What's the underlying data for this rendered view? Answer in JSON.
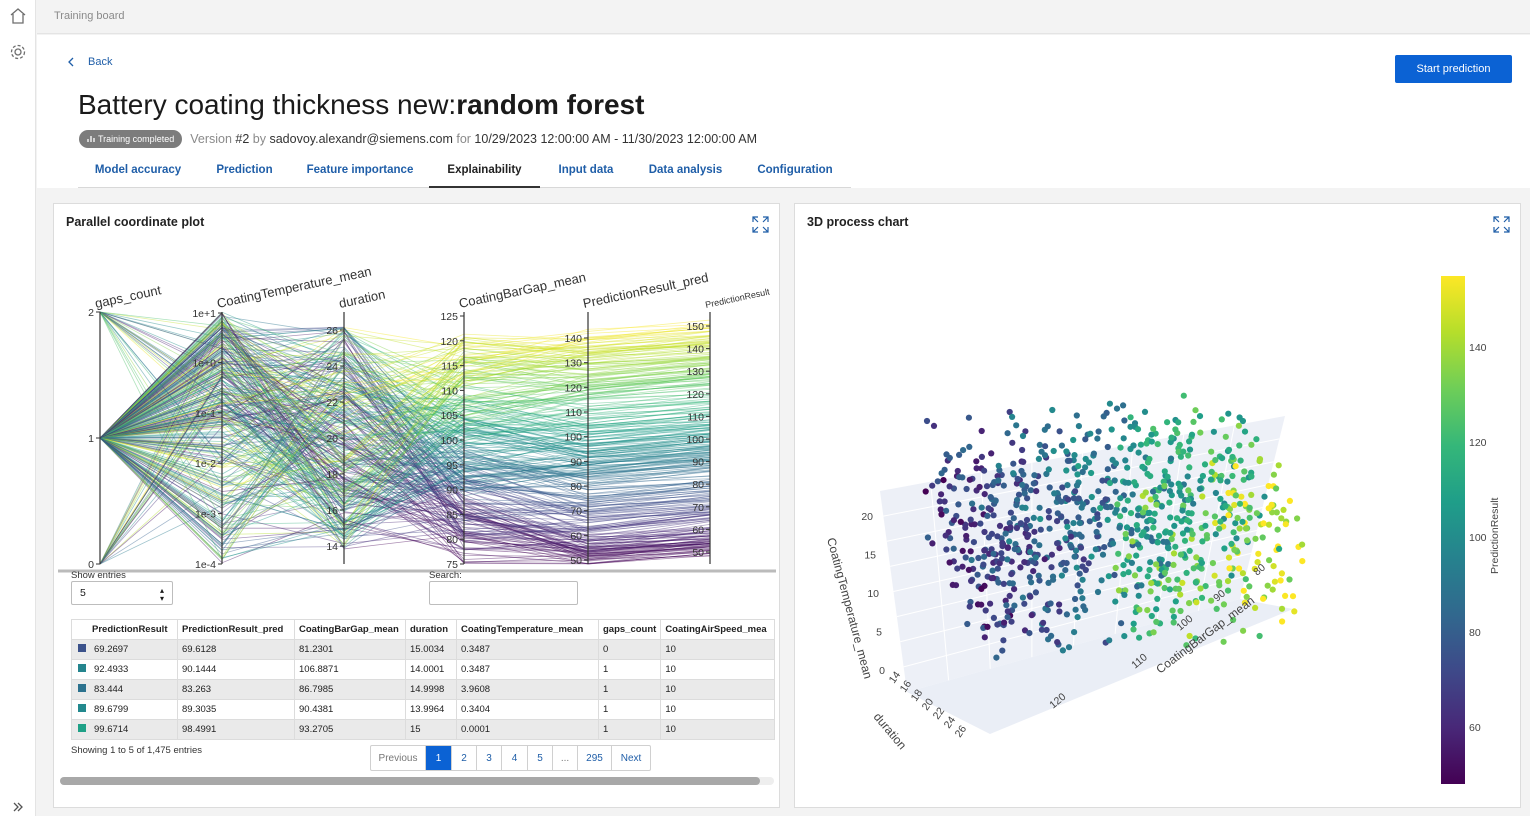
{
  "rail": {
    "home_icon": "home-icon",
    "settings_icon": "settings-gear-icon",
    "expand_icon": "double-chevron-right-icon"
  },
  "topbar": {
    "breadcrumb": "Training board"
  },
  "header": {
    "back_label": "Back",
    "start_button": "Start prediction",
    "title_main": "Battery coating thickness new:",
    "title_bold": "random forest",
    "badge": "Training completed",
    "version_prefix": "Version",
    "version": "#2",
    "by": "by",
    "author": "sadovoy.alexandr@siemens.com",
    "for": "for",
    "range": "10/29/2023 12:00:00 AM - 11/30/2023 12:00:00 AM"
  },
  "tabs": [
    {
      "label": "Model accuracy",
      "active": false
    },
    {
      "label": "Prediction",
      "active": false
    },
    {
      "label": "Feature importance",
      "active": false
    },
    {
      "label": "Explainability",
      "active": true
    },
    {
      "label": "Input data",
      "active": false
    },
    {
      "label": "Data analysis",
      "active": false
    },
    {
      "label": "Configuration",
      "active": false
    }
  ],
  "left_card": {
    "title": "Parallel coordinate plot",
    "show_entries_label": "Show entries",
    "show_entries_value": "5",
    "search_label": "Search:",
    "columns": [
      "PredictionResult",
      "PredictionResult_pred",
      "CoatingBarGap_mean",
      "duration",
      "CoatingTemperature_mean",
      "gaps_count",
      "CoatingAirSpeed_mea"
    ],
    "rows": [
      {
        "color": "#3b528b",
        "cells": [
          "69.2697",
          "69.6128",
          "81.2301",
          "15.0034",
          "0.3487",
          "0",
          "10"
        ]
      },
      {
        "color": "#25858e",
        "cells": [
          "92.4933",
          "90.1444",
          "106.8871",
          "14.0001",
          "0.3487",
          "1",
          "10"
        ]
      },
      {
        "color": "#2c728e",
        "cells": [
          "83.444",
          "83.263",
          "86.7985",
          "14.9998",
          "3.9608",
          "1",
          "10"
        ]
      },
      {
        "color": "#23898e",
        "cells": [
          "89.6799",
          "89.3035",
          "90.4381",
          "13.9964",
          "0.3404",
          "1",
          "10"
        ]
      },
      {
        "color": "#1fa187",
        "cells": [
          "99.6714",
          "98.4991",
          "93.2705",
          "15",
          "0.0001",
          "1",
          "10"
        ]
      }
    ],
    "showing": "Showing 1 to 5 of 1,475 entries",
    "pager": [
      "Previous",
      "1",
      "2",
      "3",
      "4",
      "5",
      "...",
      "295",
      "Next"
    ]
  },
  "parallel_chart": {
    "chart_data": {
      "type": "parallel-coordinates",
      "colorscale": "viridis",
      "axes": [
        {
          "name": "gaps_count",
          "ticks": [
            "0",
            "1",
            "2"
          ]
        },
        {
          "name": "CoatingTemperature_mean",
          "scale": "log",
          "ticks": [
            "1e-4",
            "1e-3",
            "1e-2",
            "1e-1",
            "1e+0",
            "1e+1"
          ]
        },
        {
          "name": "duration",
          "ticks": [
            "14",
            "16",
            "18",
            "20",
            "22",
            "24",
            "26"
          ]
        },
        {
          "name": "CoatingBarGap_mean",
          "ticks": [
            "75",
            "80",
            "85",
            "90",
            "95",
            "100",
            "105",
            "110",
            "115",
            "120",
            "125"
          ]
        },
        {
          "name": "PredictionResult_pred",
          "ticks": [
            "50",
            "60",
            "70",
            "80",
            "90",
            "100",
            "110",
            "120",
            "130",
            "140"
          ]
        },
        {
          "name": "PredictionResult",
          "ticks": [
            "50",
            "60",
            "70",
            "80",
            "90",
            "100",
            "110",
            "120",
            "130",
            "140",
            "150"
          ]
        }
      ]
    }
  },
  "right_card": {
    "title": "3D process chart",
    "chart_data": {
      "type": "scatter3d",
      "colorscale": "viridis",
      "x_axis": {
        "title": "duration",
        "ticks": [
          "14",
          "16",
          "18",
          "20",
          "22",
          "24",
          "26"
        ]
      },
      "y_axis": {
        "title": "CoatingBarGap_mean",
        "ticks": [
          "80",
          "90",
          "100",
          "110",
          "120"
        ]
      },
      "z_axis": {
        "title": "CoatingTemperature_mean",
        "ticks": [
          "0",
          "5",
          "10",
          "15",
          "20"
        ]
      },
      "colorbar": {
        "title": "PredictionResult",
        "ticks": [
          "60",
          "80",
          "100",
          "120",
          "140"
        ],
        "range": [
          48,
          155
        ]
      }
    }
  }
}
